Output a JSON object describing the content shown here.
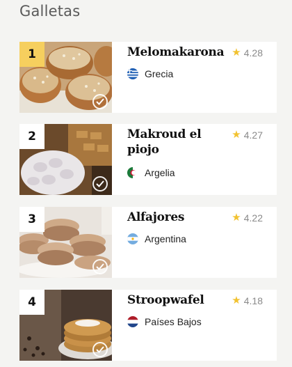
{
  "page_title": "Galletas",
  "items": [
    {
      "rank": "1",
      "name": "Melomakarona",
      "rating": "4.28",
      "country": "Grecia",
      "flag": "greece-flag-icon"
    },
    {
      "rank": "2",
      "name": "Makroud el piojo",
      "rating": "4.27",
      "country": "Argelia",
      "flag": "algeria-flag-icon"
    },
    {
      "rank": "3",
      "name": "Alfajores",
      "rating": "4.22",
      "country": "Argentina",
      "flag": "argentina-flag-icon"
    },
    {
      "rank": "4",
      "name": "Stroopwafel",
      "rating": "4.18",
      "country": "Países Bajos",
      "flag": "netherlands-flag-icon"
    }
  ],
  "colors": {
    "rank_highlight": "#f6cf5e",
    "star": "#f2c230",
    "background": "#f4f4f2"
  }
}
